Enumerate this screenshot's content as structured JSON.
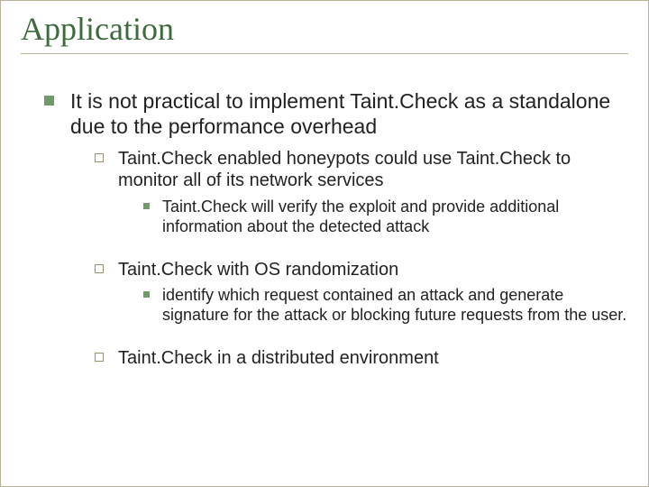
{
  "title": "Application",
  "level1": {
    "text": "It is not practical to implement Taint.Check as a standalone due to the performance overhead"
  },
  "level2_1": {
    "text": "Taint.Check enabled honeypots could use Taint.Check to monitor all of its network services"
  },
  "level3_1": {
    "text": "Taint.Check will verify the exploit and provide additional information about the detected attack"
  },
  "level2_2": {
    "text": "Taint.Check with OS randomization"
  },
  "level3_2": {
    "text": "identify which request contained an attack and generate signature for the attack or blocking future requests from the user."
  },
  "level2_3": {
    "text": "Taint.Check in a distributed environment"
  }
}
